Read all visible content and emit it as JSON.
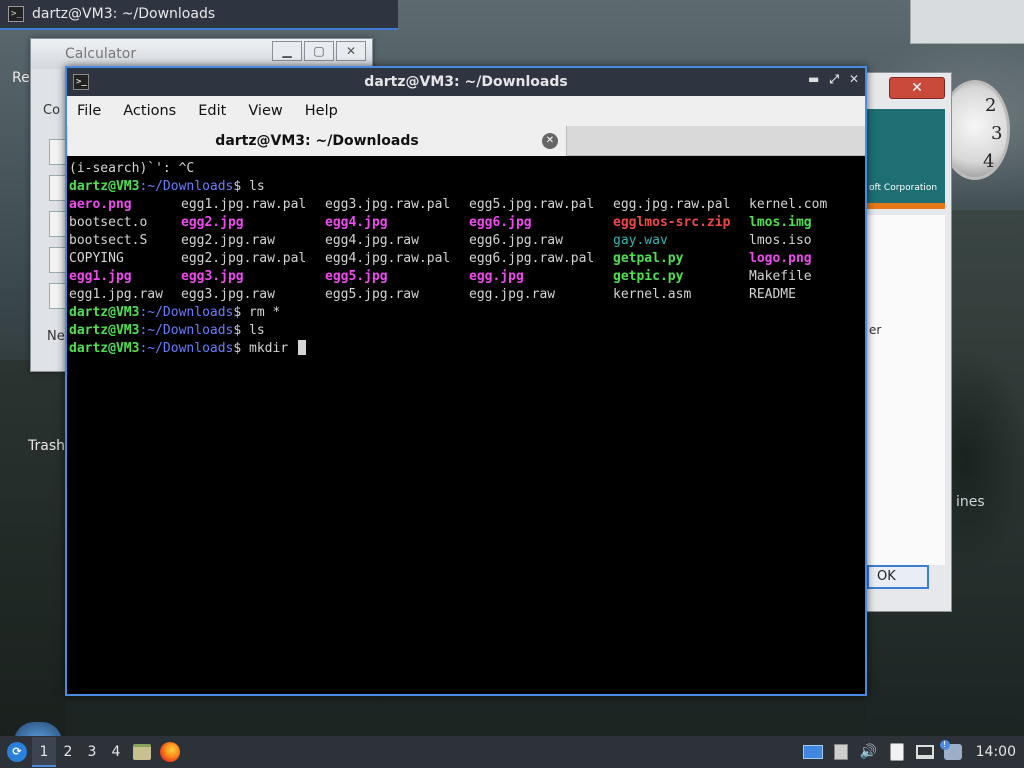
{
  "top_bar": {
    "title": "dartz@VM3: ~/Downloads"
  },
  "calculator": {
    "title": "Calculator"
  },
  "desktop": {
    "trash_label": "Trash",
    "frag_re": "Re",
    "frag_co": "Co",
    "frag_ne": "Ne"
  },
  "dialog": {
    "banner_text": "oft Corporation",
    "frag_text": "er",
    "ok_label": "OK",
    "close_label": "✕",
    "side_text": "ines"
  },
  "clock": {
    "numbers": [
      "2",
      "3",
      "4"
    ]
  },
  "terminal": {
    "window_title": "dartz@VM3: ~/Downloads",
    "menu": [
      "File",
      "Actions",
      "Edit",
      "View",
      "Help"
    ],
    "tab_title": "dartz@VM3: ~/Downloads",
    "isearch_line": "(i-search)`': ^C",
    "prompt_user": "dartz@VM3",
    "prompt_path": ":~/Downloads",
    "prompt_symbol": "$ ",
    "cmd1": "ls",
    "cmd2": "rm *",
    "cmd3": "ls",
    "cmd4": "mkdir ",
    "listing": [
      [
        {
          "name": "aero.png",
          "type": "img"
        },
        {
          "name": "egg1.jpg.raw.pal",
          "type": "plain"
        },
        {
          "name": "egg3.jpg.raw.pal",
          "type": "plain"
        },
        {
          "name": "egg5.jpg.raw.pal",
          "type": "plain"
        },
        {
          "name": "egg.jpg.raw.pal",
          "type": "plain"
        },
        {
          "name": "kernel.com",
          "type": "plain"
        }
      ],
      [
        {
          "name": "bootsect.o",
          "type": "plain"
        },
        {
          "name": "egg2.jpg",
          "type": "img"
        },
        {
          "name": "egg4.jpg",
          "type": "img"
        },
        {
          "name": "egg6.jpg",
          "type": "img"
        },
        {
          "name": "egglmos-src.zip",
          "type": "zip"
        },
        {
          "name": "lmos.img",
          "type": "exec"
        }
      ],
      [
        {
          "name": "bootsect.S",
          "type": "plain"
        },
        {
          "name": "egg2.jpg.raw",
          "type": "plain"
        },
        {
          "name": "egg4.jpg.raw",
          "type": "plain"
        },
        {
          "name": "egg6.jpg.raw",
          "type": "plain"
        },
        {
          "name": "gay.wav",
          "type": "audio"
        },
        {
          "name": "lmos.iso",
          "type": "plain"
        }
      ],
      [
        {
          "name": "COPYING",
          "type": "plain"
        },
        {
          "name": "egg2.jpg.raw.pal",
          "type": "plain"
        },
        {
          "name": "egg4.jpg.raw.pal",
          "type": "plain"
        },
        {
          "name": "egg6.jpg.raw.pal",
          "type": "plain"
        },
        {
          "name": "getpal.py",
          "type": "exec"
        },
        {
          "name": "logo.png",
          "type": "img"
        }
      ],
      [
        {
          "name": "egg1.jpg",
          "type": "img"
        },
        {
          "name": "egg3.jpg",
          "type": "img"
        },
        {
          "name": "egg5.jpg",
          "type": "img"
        },
        {
          "name": "egg.jpg",
          "type": "img"
        },
        {
          "name": "getpic.py",
          "type": "exec"
        },
        {
          "name": "Makefile",
          "type": "plain"
        }
      ],
      [
        {
          "name": "egg1.jpg.raw",
          "type": "plain"
        },
        {
          "name": "egg3.jpg.raw",
          "type": "plain"
        },
        {
          "name": "egg5.jpg.raw",
          "type": "plain"
        },
        {
          "name": "egg.jpg.raw",
          "type": "plain"
        },
        {
          "name": "kernel.asm",
          "type": "plain"
        },
        {
          "name": "README",
          "type": "plain"
        }
      ]
    ]
  },
  "taskbar": {
    "workspaces": [
      "1",
      "2",
      "3",
      "4"
    ],
    "active_workspace": "1",
    "time": "14:00",
    "icons": [
      "start-menu-icon",
      "file-manager-icon",
      "firefox-icon",
      "show-desktop-icon",
      "volume-icon",
      "clipboard-icon",
      "network-icon",
      "notification-icon"
    ]
  },
  "colors": {
    "prompt_user": "#4ee04e",
    "prompt_path": "#6a7cff",
    "image_file": "#f04af0",
    "executable_file": "#4ee04e",
    "archive_file": "#f04848",
    "audio_file": "#2fb5b5",
    "accent": "#4a8ae0"
  }
}
